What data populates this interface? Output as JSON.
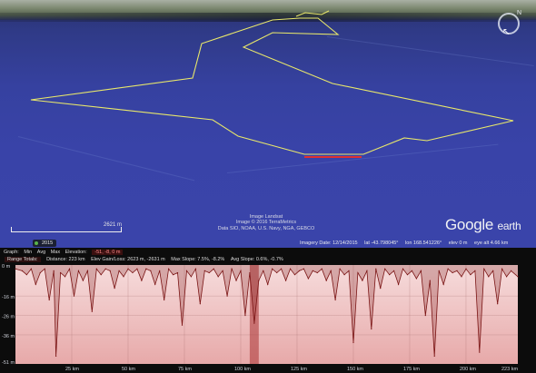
{
  "map": {
    "scale_label": "2621 m",
    "year_badge": "2015",
    "credits": [
      "Image Landsat",
      "Image © 2016 TerraMetrics",
      "Data SIO, NOAA, U.S. Navy, NGA, GEBCO"
    ],
    "logo_google": "Google",
    "logo_earth": "earth",
    "compass_n": "N",
    "status": {
      "imagery_date": "Imagery Date: 12/14/2015",
      "lat": "lat  -43.798045°",
      "lon": "lon  168.541226°",
      "elev": "elev    0 m",
      "eye_alt": "eye alt   4.66 km"
    },
    "colors": {
      "track": "#e9e86a",
      "selection": "#e03030",
      "sea": "#3943a8"
    }
  },
  "profile": {
    "toolbar1": {
      "graph": "Graph:",
      "min": "Min",
      "avg": "Avg",
      "max": "Max",
      "elevation": "Elevation:",
      "elevation_value": "-51, -8, 0 m"
    },
    "toolbar2": {
      "range_totals": "Range Totals:",
      "distance": "Distance: 223 km",
      "gain_loss": "Elev Gain/Loss: 2623 m, -2631 m",
      "max_slope": "Max Slope: 7.5%, -8.2%",
      "avg_slope": "Avg Slope: 0.6%, -0.7%"
    },
    "y_ticks": [
      "0 m",
      "-16 m",
      "-26 m",
      "-36 m",
      "-51 m"
    ],
    "x_ticks": [
      "25 km",
      "50 km",
      "75 km",
      "100 km",
      "125 km",
      "150 km",
      "175 km",
      "200 km",
      "223 km"
    ]
  },
  "chart_data": {
    "type": "area",
    "title": "",
    "xlabel": "",
    "ylabel": "",
    "x_unit": "km",
    "y_unit": "m",
    "xlim": [
      0,
      223
    ],
    "ylim": [
      -51,
      0
    ],
    "selection_km": [
      104,
      108
    ],
    "series": [
      {
        "x": [
          0,
          3,
          5,
          7,
          9,
          11,
          13,
          15,
          17,
          18,
          20,
          22,
          24,
          26,
          28,
          30,
          32,
          34,
          36,
          38,
          40,
          42,
          44,
          46,
          48,
          50,
          52,
          54,
          56,
          58,
          60,
          62,
          64,
          66,
          68,
          70,
          72,
          74,
          76,
          78,
          80,
          82,
          84,
          86,
          88,
          90,
          92,
          94,
          96,
          98,
          100,
          102,
          104,
          106,
          108,
          110,
          112,
          114,
          116,
          118,
          120,
          122,
          124,
          126,
          128,
          130,
          132,
          134,
          136,
          138,
          140,
          142,
          144,
          146,
          148,
          150,
          152,
          154,
          156,
          158,
          160,
          162,
          164,
          166,
          168,
          170,
          172,
          174,
          176,
          178,
          180,
          182,
          184,
          186,
          188,
          190,
          192,
          194,
          196,
          198,
          200,
          202,
          204,
          206,
          208,
          210,
          212,
          214,
          216,
          218,
          220,
          223
        ],
        "y": [
          -2,
          -3,
          -5,
          -2,
          -10,
          -4,
          -2,
          -18,
          -3,
          -47,
          -4,
          -6,
          -2,
          -16,
          -3,
          -8,
          -3,
          -24,
          -2,
          -5,
          -2,
          -3,
          -12,
          -3,
          -6,
          -2,
          -4,
          -2,
          -8,
          -2,
          -3,
          -10,
          -3,
          -18,
          -2,
          -5,
          -4,
          -31,
          -3,
          -6,
          -2,
          -20,
          -3,
          -4,
          -2,
          -6,
          -3,
          -16,
          -2,
          -8,
          -3,
          -26,
          -4,
          -30,
          -8,
          -3,
          -10,
          -2,
          -4,
          -2,
          -8,
          -2,
          -5,
          -3,
          -2,
          -7,
          -3,
          -4,
          -2,
          -8,
          -3,
          -18,
          -2,
          -5,
          -3,
          -40,
          -4,
          -8,
          -3,
          -33,
          -2,
          -12,
          -2,
          -5,
          -3,
          -10,
          -2,
          -5,
          -3,
          -7,
          -3,
          -26,
          -8,
          -47,
          -3,
          -10,
          -2,
          -4,
          -3,
          -6,
          -2,
          -5,
          -3,
          -45,
          -2,
          -6,
          -3,
          -20,
          -2,
          -6,
          -3,
          -6
        ]
      }
    ]
  }
}
